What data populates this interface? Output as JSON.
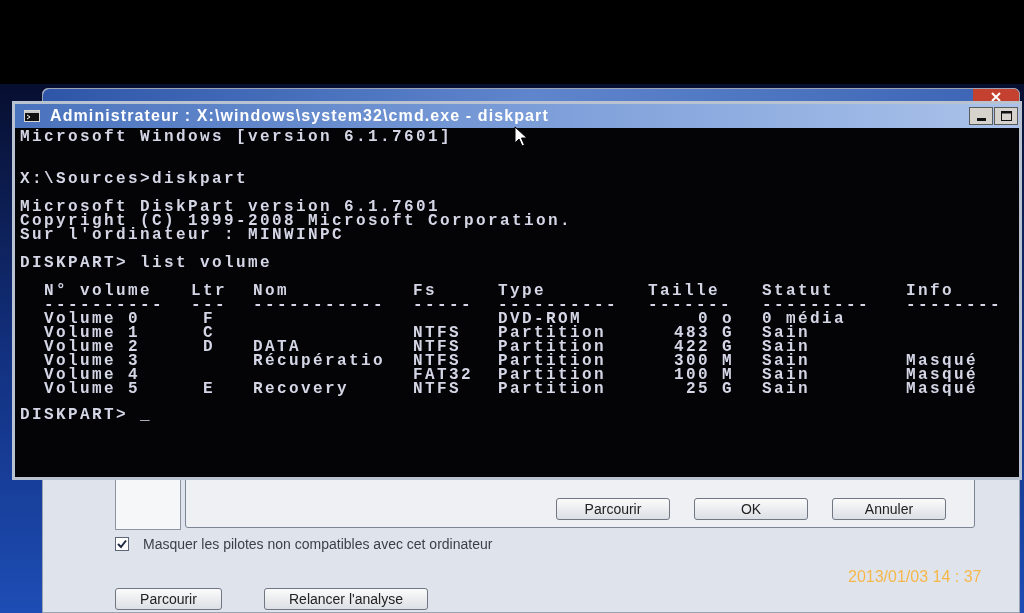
{
  "console_window": {
    "title": "Administrateur : X:\\windows\\system32\\cmd.exe - diskpart",
    "blocks": [
      [
        "Microsoft Windows [version 6.1.7601]"
      ],
      [
        "X:\\Sources>diskpart"
      ],
      [
        "Microsoft DiskPart version 6.1.7601",
        "Copyright (C) 1999-2008 Microsoft Corporation.",
        "Sur l'ordinateur : MINWINPC"
      ],
      [
        "DISKPART> list volume"
      ]
    ],
    "volume_table": {
      "columns": [
        {
          "heading": "N° volume",
          "rule": "----------"
        },
        {
          "heading": "Ltr",
          "rule": "---"
        },
        {
          "heading": "Nom",
          "rule": "-----------"
        },
        {
          "heading": "Fs",
          "rule": "-----"
        },
        {
          "heading": "Type",
          "rule": "----------"
        },
        {
          "heading": "Taille",
          "rule": "-------"
        },
        {
          "heading": "Statut",
          "rule": "---------"
        },
        {
          "heading": "Info",
          "rule": "--------"
        }
      ],
      "rows": [
        {
          "volume": "Volume 0",
          "ltr": "F",
          "type": "DVD-ROM",
          "taille": "0 o",
          "statut": "0 média"
        },
        {
          "volume": "Volume 1",
          "ltr": "C",
          "fs": "NTFS",
          "type": "Partition",
          "taille": "483 G",
          "statut": "Sain"
        },
        {
          "volume": "Volume 2",
          "ltr": "D",
          "nom": "DATA",
          "fs": "NTFS",
          "type": "Partition",
          "taille": "422 G",
          "statut": "Sain"
        },
        {
          "volume": "Volume 3",
          "nom": "Récupératio",
          "fs": "NTFS",
          "type": "Partition",
          "taille": "300 M",
          "statut": "Sain",
          "info": "Masqué"
        },
        {
          "volume": "Volume 4",
          "fs": "FAT32",
          "type": "Partition",
          "taille": "100 M",
          "statut": "Sain",
          "info": "Masqué"
        },
        {
          "volume": "Volume 5",
          "ltr": "E",
          "nom": "Recovery",
          "fs": "NTFS",
          "type": "Partition",
          "taille": "25 G",
          "statut": "Sain",
          "info": "Masqué"
        }
      ]
    },
    "prompt": "DISKPART> _"
  },
  "browse_dialog": {
    "buttons": [
      "Parcourir",
      "OK",
      "Annuler"
    ]
  },
  "setup_window": {
    "hide_incompatible_drivers": {
      "label": "Masquer les pilotes non compatibles avec cet ordinateur",
      "checked": true
    },
    "buttons": [
      "Parcourir",
      "Relancer l'analyse"
    ]
  },
  "date_stamp": "2013/01/03 14 : 37"
}
